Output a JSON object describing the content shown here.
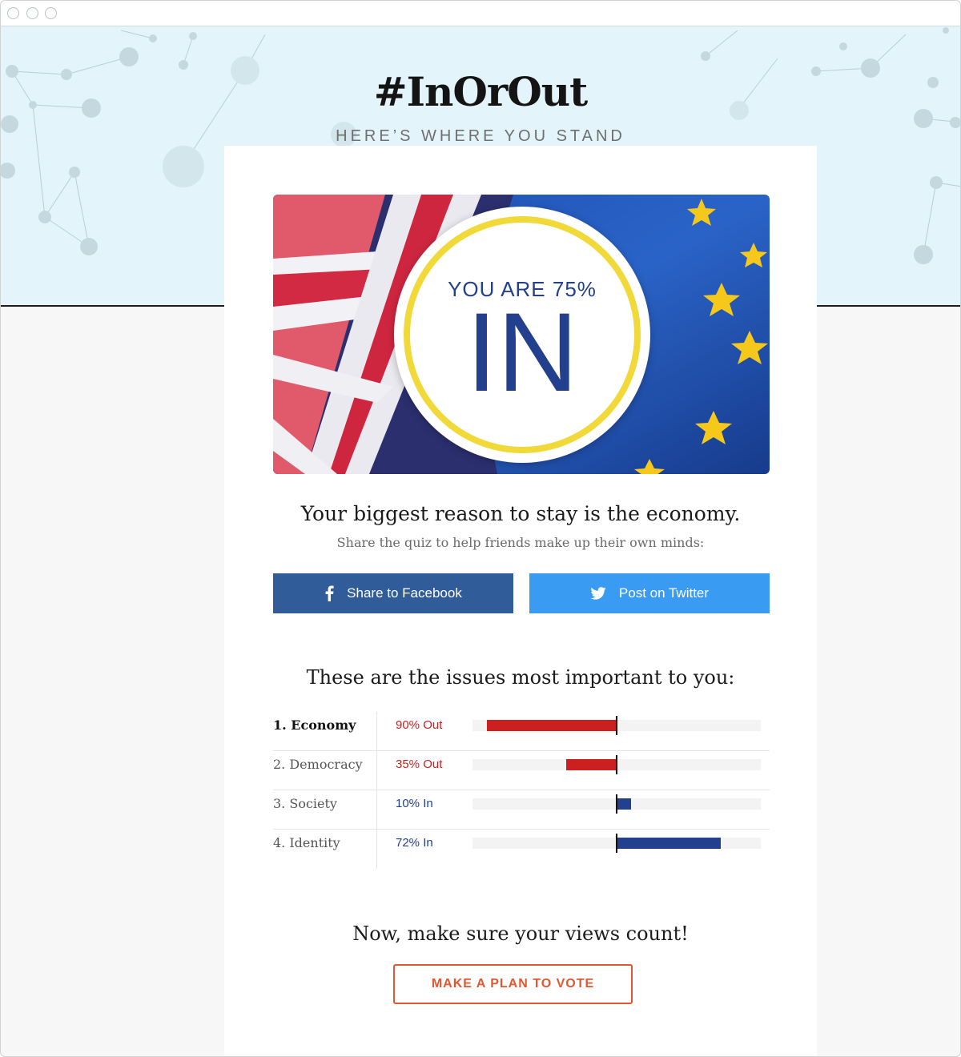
{
  "header": {
    "title": "#InOrOut",
    "subtitle": "HERE’S WHERE YOU STAND"
  },
  "result": {
    "prefix": "YOU ARE 75%",
    "verdict": "IN",
    "percent_in": 75
  },
  "reason": {
    "heading": "Your biggest reason to stay is the economy.",
    "subtext": "Share the quiz to help friends make up their own minds:"
  },
  "share": {
    "facebook_label": "Share to Facebook",
    "twitter_label": "Post on Twitter"
  },
  "issues": {
    "heading": "These are the issues most important to you:",
    "rows": [
      {
        "name": "1. Economy",
        "value": "90% Out",
        "direction": "out",
        "percent": 90
      },
      {
        "name": "2. Democracy",
        "value": "35% Out",
        "direction": "out",
        "percent": 35
      },
      {
        "name": "3. Society",
        "value": "10% In",
        "direction": "in",
        "percent": 10
      },
      {
        "name": "4. Identity",
        "value": "72% In",
        "direction": "in",
        "percent": 72
      }
    ]
  },
  "cta": {
    "heading": "Now, make sure your views count!",
    "button_label": "MAKE A PLAN TO VOTE"
  },
  "colors": {
    "out": "#cc1f1f",
    "in": "#23408e",
    "facebook": "#305c99",
    "twitter": "#3a9bf2",
    "cta": "#e4572e",
    "ring": "#f2d93a",
    "hero_bg": "#e3f4fb"
  },
  "icons": {
    "facebook": "facebook-icon",
    "twitter": "twitter-icon"
  }
}
